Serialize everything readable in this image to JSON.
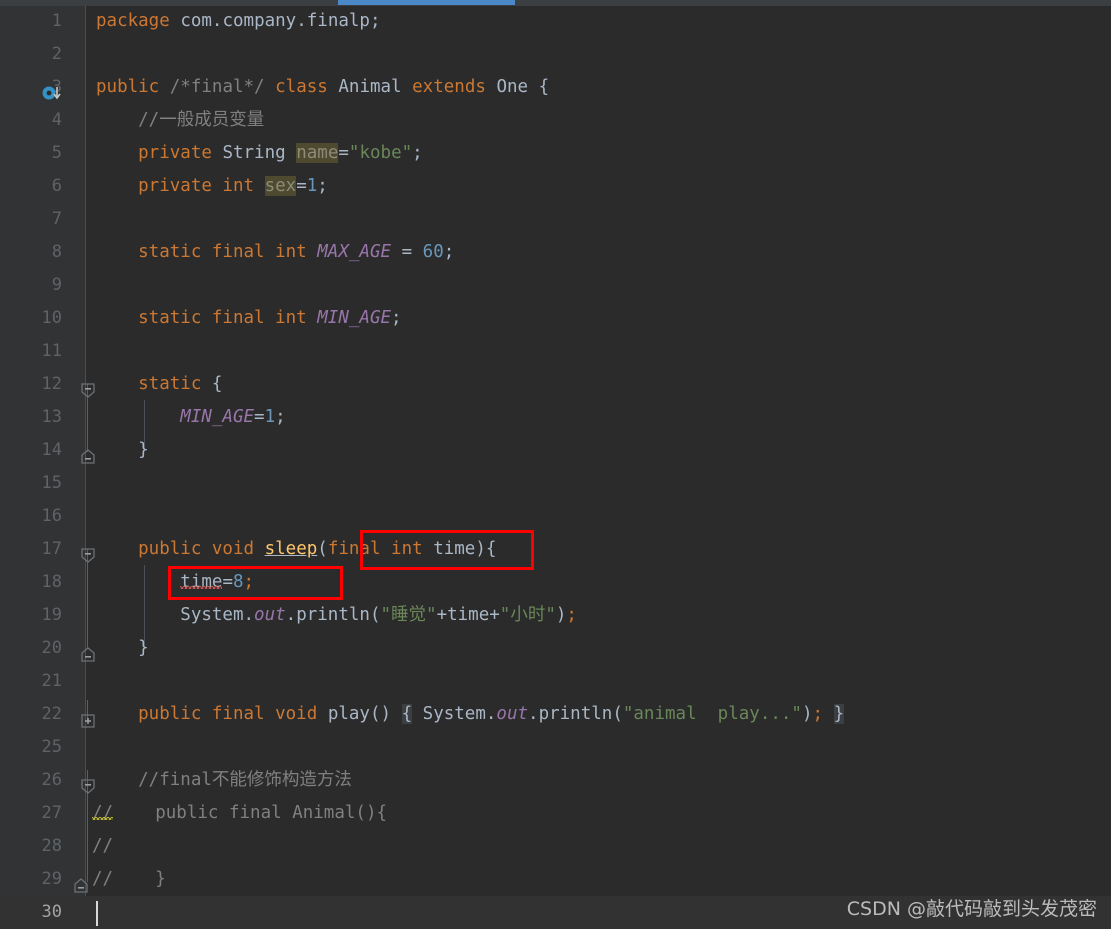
{
  "window": {
    "app": "IntelliJ IDEA code editor",
    "theme": "Darcula",
    "background": "#2b2b2b",
    "accent": "#4a88c7"
  },
  "tab": {
    "underline_color": "#4a88c7"
  },
  "gutter": {
    "background": "#313335",
    "implementation_marker_line": 3,
    "implementation_marker_color": "#3592c4"
  },
  "lines": [
    {
      "no": "1",
      "text": "package com.company.finalp;"
    },
    {
      "no": "2",
      "text": ""
    },
    {
      "no": "3",
      "text": "public /*final*/ class Animal extends One {"
    },
    {
      "no": "4",
      "text": "    //一般成员变量"
    },
    {
      "no": "5",
      "text": "    private String name=\"kobe\";"
    },
    {
      "no": "6",
      "text": "    private int sex=1;"
    },
    {
      "no": "7",
      "text": ""
    },
    {
      "no": "8",
      "text": "    static final int MAX_AGE = 60;"
    },
    {
      "no": "9",
      "text": ""
    },
    {
      "no": "10",
      "text": "    static final int MIN_AGE;"
    },
    {
      "no": "11",
      "text": ""
    },
    {
      "no": "12",
      "text": "    static {"
    },
    {
      "no": "13",
      "text": "        MIN_AGE=1;"
    },
    {
      "no": "14",
      "text": "    }"
    },
    {
      "no": "15",
      "text": ""
    },
    {
      "no": "16",
      "text": ""
    },
    {
      "no": "17",
      "text": "    public void sleep(final int time){"
    },
    {
      "no": "18",
      "text": "        time=8;"
    },
    {
      "no": "19",
      "text": "        System.out.println(\"睡觉\"+time+\"小时\");"
    },
    {
      "no": "20",
      "text": "    }"
    },
    {
      "no": "21",
      "text": ""
    },
    {
      "no": "22",
      "text": "    public final void play() { System.out.println(\"animal  play...\"); }"
    },
    {
      "no": "25",
      "text": ""
    },
    {
      "no": "26",
      "text": "    //final不能修饰构造方法"
    },
    {
      "no": "27",
      "text": "//    public final Animal(){"
    },
    {
      "no": "28",
      "text": "//"
    },
    {
      "no": "29",
      "text": "//    }"
    },
    {
      "no": "30",
      "text": ""
    }
  ],
  "tokens": {
    "keywords": [
      "package",
      "public",
      "class",
      "extends",
      "private",
      "static",
      "final",
      "int",
      "void"
    ],
    "types": [
      "String",
      "Animal",
      "One",
      "System"
    ],
    "strings": [
      "\"kobe\"",
      "\"睡觉\"",
      "\"小时\"",
      "\"animal  play...\""
    ],
    "numbers": [
      "1",
      "60",
      "8"
    ],
    "comments": [
      "/*final*/",
      "//一般成员变量",
      "//final不能修饰构造方法"
    ],
    "fields": [
      "name",
      "sex",
      "MAX_AGE",
      "MIN_AGE",
      "out"
    ],
    "methods": [
      "sleep",
      "play",
      "println"
    ]
  },
  "colors": {
    "keyword": "#cc7832",
    "string": "#6a8759",
    "number": "#6897bb",
    "comment": "#808080",
    "field": "#9876aa",
    "method": "#ffc66d",
    "default_text": "#a9b7c6",
    "line_number": "#606366",
    "current_line_number": "#a4a3a3",
    "warning_highlight": "#4d4a30",
    "error_underline": "#c75450",
    "warning_underline": "#bbb529",
    "annotation_box": "#ff0000"
  },
  "annotations": [
    {
      "name": "final-int-time-box",
      "target": "final int time",
      "line": "17",
      "color": "#ff0000"
    },
    {
      "name": "time-assign-box",
      "target": "time=8;",
      "line": "18",
      "color": "#ff0000"
    }
  ],
  "folding": {
    "expanded_lines": [
      "12",
      "17",
      "26"
    ],
    "collapsed_lines": [
      "22"
    ],
    "end_lines": [
      "14",
      "20",
      "29"
    ]
  },
  "caret": {
    "line": "30",
    "column": "1"
  },
  "watermark": {
    "text": "CSDN @敲代码敲到头发茂密"
  }
}
